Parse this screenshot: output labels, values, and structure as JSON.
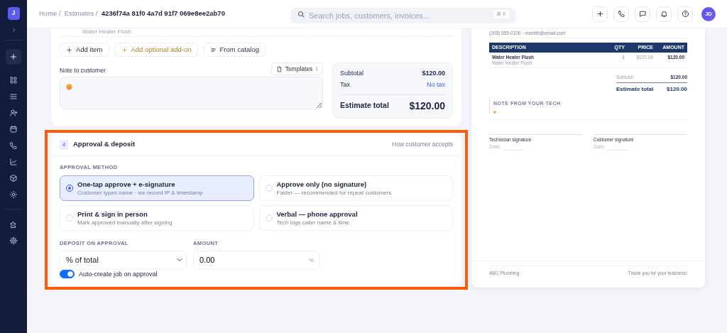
{
  "sidebar": {
    "logo": "J"
  },
  "header": {
    "breadcrumbs": [
      {
        "label": "Home /",
        "current": false
      },
      {
        "label": "Estimates /",
        "current": false
      },
      {
        "label": "4236f74a 81f0 4a7d 91f7 069e8ee2ab70",
        "current": true
      }
    ],
    "search": {
      "placeholder": "Search jobs, customers, invoices...",
      "shortcut": "⌘ K"
    },
    "avatar": "JD"
  },
  "line_items": {
    "item_detail": "Water Heater Flush",
    "buttons": [
      {
        "label": "Add item",
        "kind": "add"
      },
      {
        "label": "Add optional add-on",
        "kind": "addon"
      },
      {
        "label": "From catalog",
        "kind": "catalog"
      }
    ]
  },
  "note": {
    "label": "Note to customer",
    "templates_button": "Templates",
    "templates_count": "1"
  },
  "totals": {
    "subtotal_label": "Subtotal",
    "subtotal": "$120.00",
    "tax_label": "Tax",
    "tax": "No tax",
    "total_label": "Estimate total",
    "total": "$120.00"
  },
  "approval": {
    "step": "4",
    "title": "Approval & deposit",
    "hint": "How customer accepts",
    "method_label": "APPROVAL METHOD",
    "options": [
      {
        "title": "One-tap approve + e-signature",
        "description": "Customer types name · we record IP & timestamp",
        "selected": true
      },
      {
        "title": "Approve only (no signature)",
        "description": "Faster — recommended for repeat customers",
        "selected": false
      },
      {
        "title": "Print & sign in person",
        "description": "Mark approved manually after signing",
        "selected": false
      },
      {
        "title": "Verbal — phone approval",
        "description": "Tech logs caller name & time",
        "selected": false
      }
    ],
    "deposit_label": "DEPOSIT ON APPROVAL",
    "deposit_value": "% of total",
    "amount_label": "AMOUNT",
    "amount_value": "0.00",
    "amount_unit": "%",
    "auto_job": {
      "label": "Auto-create job on approval",
      "on": true
    }
  },
  "preview": {
    "contact": "(208) 555-0100 · msmith@email.com",
    "columns": [
      "DESCRIPTION",
      "QTY",
      "PRICE",
      "AMOUNT"
    ],
    "rows": [
      {
        "description": "Water Heater Flush",
        "detail": "Water Heater Flush",
        "qty": "1",
        "price": "$120.00",
        "amount": "$120.00"
      }
    ],
    "subtotal_label": "Subtotal",
    "subtotal": "$120.00",
    "total_label": "Estimate total",
    "total": "$120.00",
    "note_label": "NOTE FROM YOUR TECH",
    "signatures": [
      {
        "label": "Technician signature",
        "date_label": "Date:"
      },
      {
        "label": "Customer signature",
        "date_label": "Date:"
      }
    ],
    "footer_left": "ABC Plumbing",
    "footer_right": "Thank you for your business!"
  }
}
